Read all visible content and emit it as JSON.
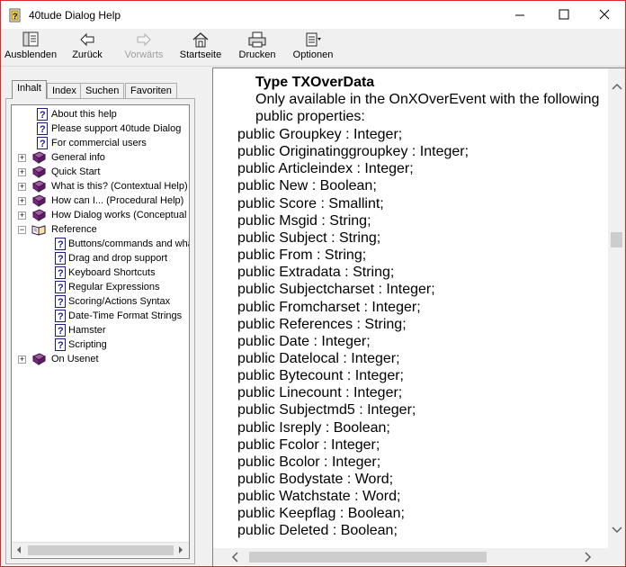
{
  "window": {
    "title": "40tude Dialog Help",
    "controls": {
      "minimize": "minimize-icon",
      "maximize": "maximize-icon",
      "close": "close-icon"
    }
  },
  "toolbar": {
    "hide": "Ausblenden",
    "back": "Zurück",
    "forward": "Vorwärts",
    "home": "Startseite",
    "print": "Drucken",
    "options": "Optionen"
  },
  "tabs": {
    "contents": "Inhalt",
    "index": "Index",
    "search": "Suchen",
    "favorites": "Favoriten",
    "active": "Inhalt"
  },
  "tree": [
    {
      "label": "About this help",
      "type": "page",
      "level": 1
    },
    {
      "label": "Please support 40tude Dialog",
      "type": "page",
      "level": 1
    },
    {
      "label": "For commercial users",
      "type": "page",
      "level": 1
    },
    {
      "label": "General info",
      "type": "book",
      "level": 0,
      "expander": "+"
    },
    {
      "label": "Quick Start",
      "type": "book",
      "level": 0,
      "expander": "+"
    },
    {
      "label": "What is this? (Contextual Help)",
      "type": "book",
      "level": 0,
      "expander": "+"
    },
    {
      "label": "How can I... (Procedural Help)",
      "type": "book",
      "level": 0,
      "expander": "+"
    },
    {
      "label": "How Dialog works (Conceptual I",
      "type": "book",
      "level": 0,
      "expander": "+"
    },
    {
      "label": "Reference",
      "type": "openbook",
      "level": 0,
      "expander": "-"
    },
    {
      "label": "Buttons/commands and wha",
      "type": "page",
      "level": 2
    },
    {
      "label": "Drag and drop support",
      "type": "page",
      "level": 2
    },
    {
      "label": "Keyboard Shortcuts",
      "type": "page",
      "level": 2
    },
    {
      "label": "Regular Expressions",
      "type": "page",
      "level": 2
    },
    {
      "label": "Scoring/Actions Syntax",
      "type": "page",
      "level": 2
    },
    {
      "label": "Date-Time Format Strings",
      "type": "page",
      "level": 2
    },
    {
      "label": "Hamster",
      "type": "page",
      "level": 2
    },
    {
      "label": "Scripting",
      "type": "page",
      "level": 2
    },
    {
      "label": "On Usenet",
      "type": "book",
      "level": 0,
      "expander": "+"
    }
  ],
  "content": {
    "heading": "Type  TXOverData",
    "intro": [
      "Only available in the OnXOverEvent with the following",
      "public properties:"
    ],
    "properties": [
      "public Groupkey : Integer;",
      "public Originatinggroupkey : Integer;",
      "public Articleindex : Integer;",
      "public New : Boolean;",
      "public Score : Smallint;",
      "public Msgid : String;",
      "public Subject : String;",
      "public From : String;",
      "public Extradata : String;",
      "public Subjectcharset : Integer;",
      "public Fromcharset : Integer;",
      "public References : String;",
      "public Date : Integer;",
      "public Datelocal : Integer;",
      "public Bytecount : Integer;",
      "public Linecount : Integer;",
      "public Subjectmd5 : Integer;",
      "public Isreply : Boolean;",
      "public Fcolor : Integer;",
      "public Bcolor : Integer;",
      "public Bodystate : Word;",
      "public Watchstate : Word;",
      "public Keepflag : Boolean;",
      "public Deleted : Boolean;"
    ]
  },
  "colors": {
    "window_border": "#e0262c",
    "book": "#7b2c82",
    "page_icon": "#1a1a8c"
  }
}
